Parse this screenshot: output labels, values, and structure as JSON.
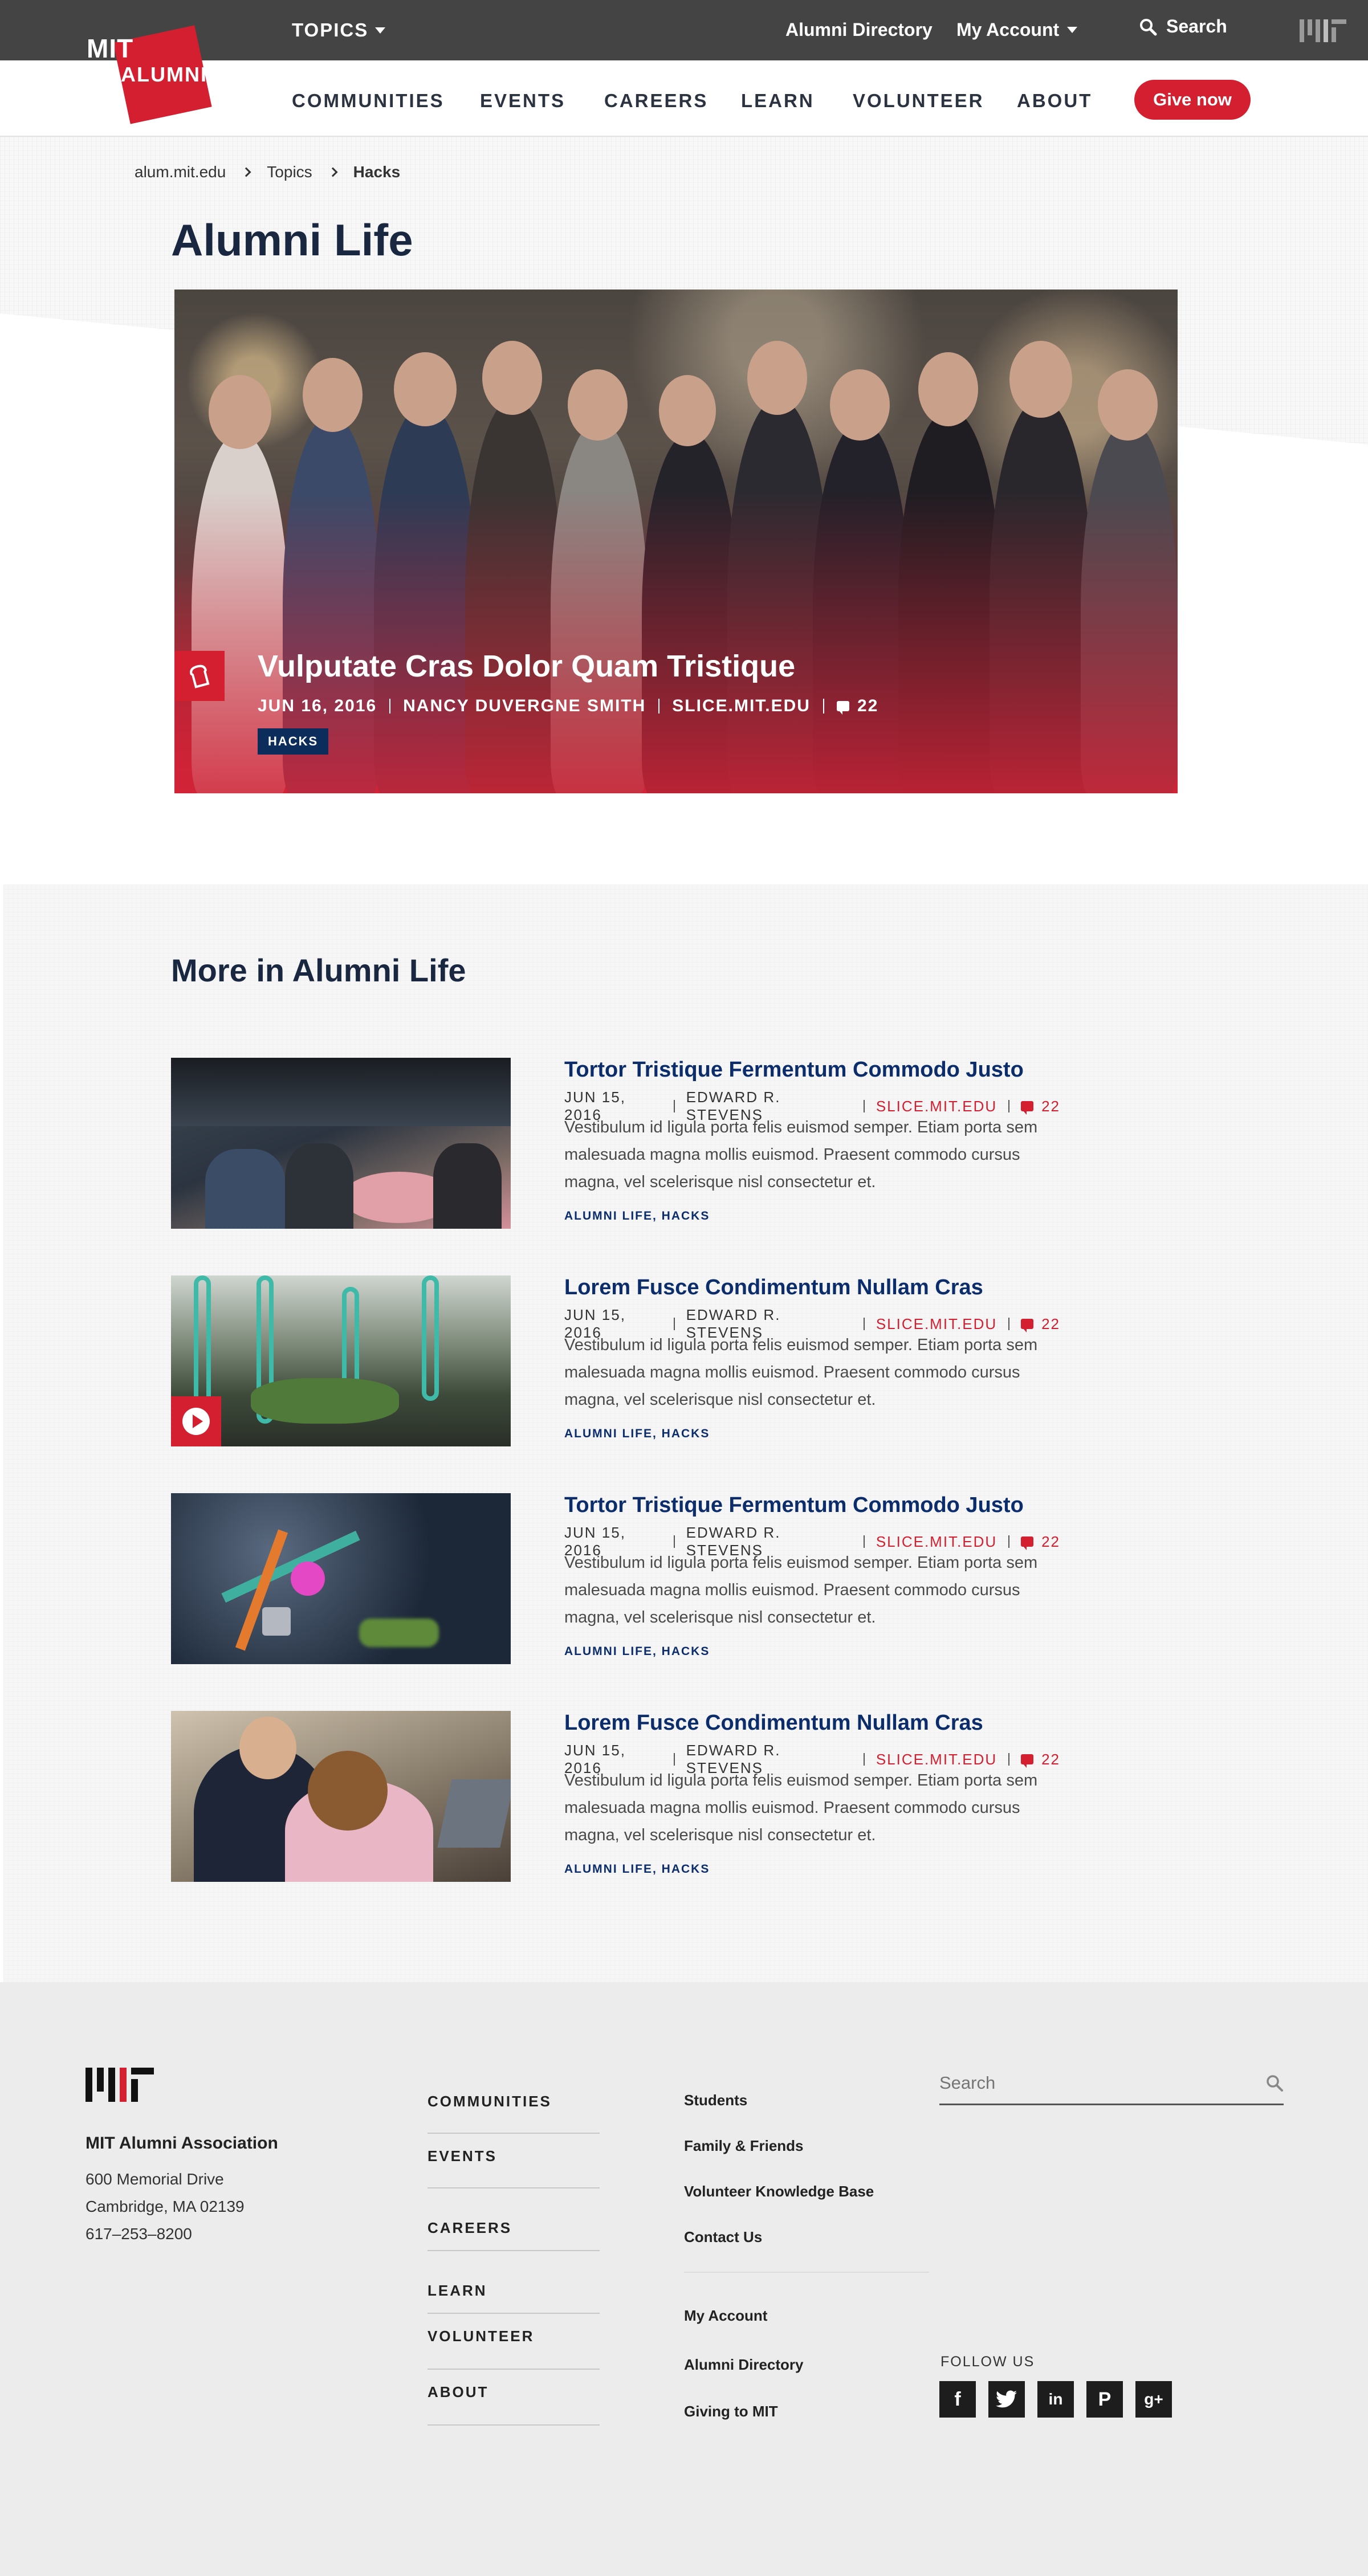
{
  "brand": {
    "mit": "MIT",
    "alumni": "ALUMNI",
    "accent": "#d31f30",
    "navy": "#0c2d6b"
  },
  "topbar": {
    "topics": "TOPICS",
    "directory": "Alumni Directory",
    "account": "My Account",
    "search": "Search"
  },
  "nav": {
    "items": [
      "COMMUNITIES",
      "EVENTS",
      "CAREERS",
      "LEARN",
      "VOLUNTEER",
      "ABOUT"
    ],
    "give": "Give now"
  },
  "breadcrumb": [
    "alum.mit.edu",
    "Topics",
    "Hacks"
  ],
  "page_title": "Alumni Life",
  "hero": {
    "title": "Vulputate Cras Dolor Quam Tristique",
    "date": "JUN 16, 2016",
    "author": "NANCY DUVERGNE SMITH",
    "source": "SLICE.MIT.EDU",
    "comments": "22",
    "tag": "HACKS"
  },
  "more": {
    "title": "More in Alumni Life",
    "articles": [
      {
        "title": "Tortor Tristique Fermentum Commodo Justo",
        "date": "JUN 15, 2016",
        "author": "EDWARD R. STEVENS",
        "source": "SLICE.MIT.EDU",
        "comments": "22",
        "description": "Vestibulum id ligula porta felis euismod semper. Etiam porta sem malesuada magna mollis euismod. Praesent commodo cursus magna, vel scelerisque nisl consectetur et.",
        "tags": "ALUMNI LIFE, HACKS"
      },
      {
        "title": "Lorem Fusce Condimentum Nullam Cras",
        "date": "JUN 15, 2016",
        "author": "EDWARD R. STEVENS",
        "source": "SLICE.MIT.EDU",
        "comments": "22",
        "description": "Vestibulum id ligula porta felis euismod semper. Etiam porta sem malesuada magna mollis euismod. Praesent commodo cursus magna, vel scelerisque nisl consectetur et.",
        "tags": "ALUMNI LIFE, HACKS"
      },
      {
        "title": "Tortor Tristique Fermentum Commodo Justo",
        "date": "JUN 15, 2016",
        "author": "EDWARD R. STEVENS",
        "source": "SLICE.MIT.EDU",
        "comments": "22",
        "description": "Vestibulum id ligula porta felis euismod semper. Etiam porta sem malesuada magna mollis euismod. Praesent commodo cursus magna, vel scelerisque nisl consectetur et.",
        "tags": "ALUMNI LIFE, HACKS"
      },
      {
        "title": "Lorem Fusce Condimentum Nullam Cras",
        "date": "JUN 15, 2016",
        "author": "EDWARD R. STEVENS",
        "source": "SLICE.MIT.EDU",
        "comments": "22",
        "description": "Vestibulum id ligula porta felis euismod semper. Etiam porta sem malesuada magna mollis euismod. Praesent commodo cursus magna, vel scelerisque nisl consectetur et.",
        "tags": "ALUMNI LIFE, HACKS"
      }
    ]
  },
  "footer": {
    "org": "MIT Alumni Association",
    "address": [
      "600 Memorial Drive",
      "Cambridge, MA 02139",
      "617–253–8200"
    ],
    "col1": [
      "COMMUNITIES",
      "EVENTS",
      "CAREERS",
      "LEARN",
      "VOLUNTEER",
      "ABOUT"
    ],
    "col2a": [
      "Students",
      "Family & Friends",
      "Volunteer Knowledge Base",
      "Contact Us"
    ],
    "col2b": [
      "My Account",
      "Alumni Directory",
      "Giving to MIT"
    ],
    "search_placeholder": "Search",
    "follow": "FOLLOW US",
    "socials": [
      {
        "icon": "facebook-icon",
        "glyph": "f"
      },
      {
        "icon": "twitter-icon",
        "glyph": "t"
      },
      {
        "icon": "linkedin-icon",
        "glyph": "in"
      },
      {
        "icon": "pinterest-icon",
        "glyph": "P"
      },
      {
        "icon": "google-plus-icon",
        "glyph": "g+"
      }
    ]
  }
}
